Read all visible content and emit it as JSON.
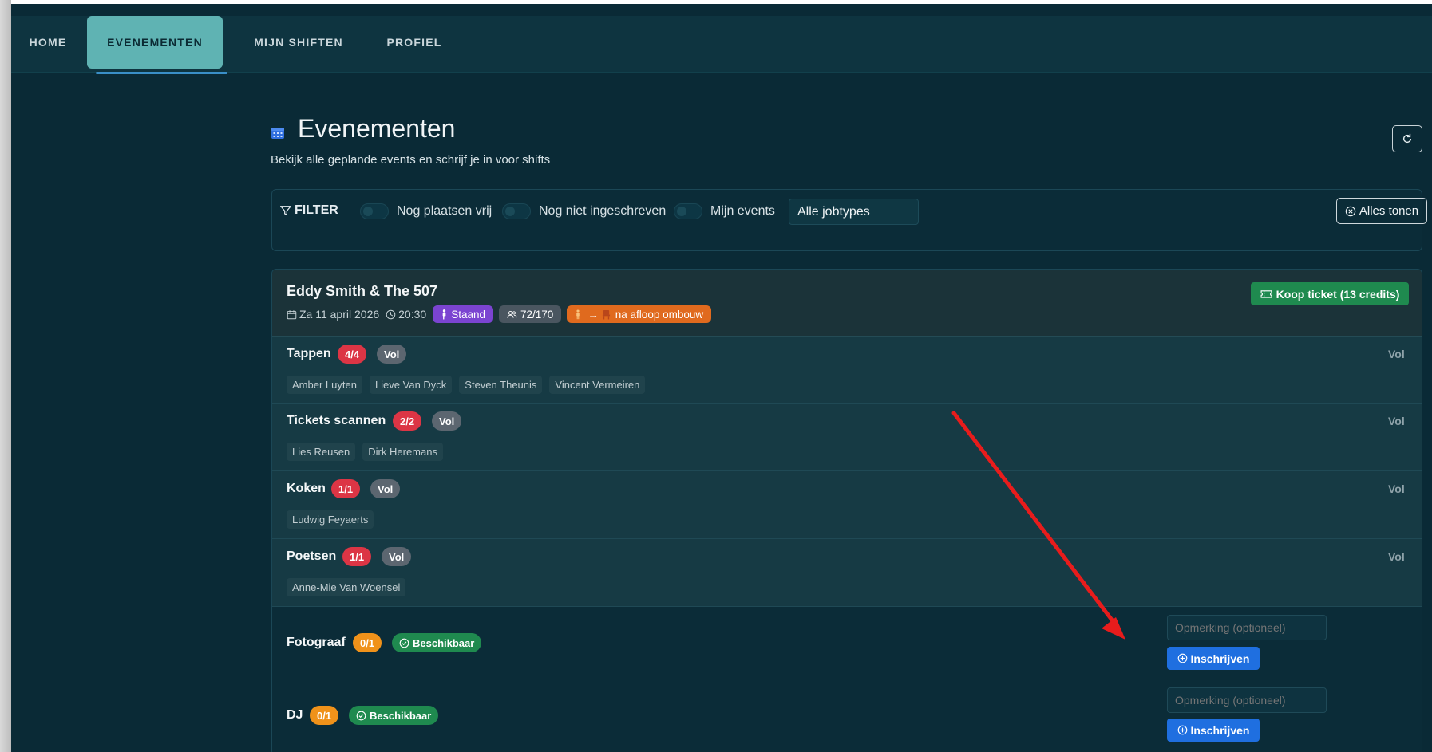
{
  "nav": {
    "items": [
      {
        "label": "HOME"
      },
      {
        "label": "EVENEMENTEN"
      },
      {
        "label": "MIJN SHIFTEN"
      },
      {
        "label": "PROFIEL"
      }
    ]
  },
  "header": {
    "title": "Evenementen",
    "subtitle": "Bekijk alle geplande events en schrijf je in voor shifts"
  },
  "filter": {
    "label": "FILTER",
    "toggles": [
      {
        "label": "Nog plaatsen vrij"
      },
      {
        "label": "Nog niet ingeschreven"
      },
      {
        "label": "Mijn events"
      }
    ],
    "jobtype_select": "Alle jobtypes",
    "reset_label": "Alles tonen"
  },
  "event": {
    "title": "Eddy Smith & The 507",
    "date": "Za 11 april 2026",
    "time": "20:30",
    "type_badge": "Staand",
    "capacity": "72/170",
    "arrow_glyph": "→",
    "note_badge": "na afloop ombouw",
    "ticket_button": "Koop ticket (13 credits)",
    "jobs_full": [
      {
        "name": "Tappen",
        "count": "4/4",
        "status": "Vol",
        "right": "Vol",
        "volunteers": [
          "Amber Luyten",
          "Lieve Van Dyck",
          "Steven Theunis",
          "Vincent Vermeiren"
        ]
      },
      {
        "name": "Tickets scannen",
        "count": "2/2",
        "status": "Vol",
        "right": "Vol",
        "volunteers": [
          "Lies Reusen",
          "Dirk Heremans"
        ]
      },
      {
        "name": "Koken",
        "count": "1/1",
        "status": "Vol",
        "right": "Vol",
        "volunteers": [
          "Ludwig Feyaerts"
        ]
      },
      {
        "name": "Poetsen",
        "count": "1/1",
        "status": "Vol",
        "right": "Vol",
        "volunteers": [
          "Anne-Mie Van Woensel"
        ]
      }
    ],
    "jobs_open": [
      {
        "name": "Fotograaf",
        "count": "0/1",
        "status": "Beschikbaar",
        "remark_placeholder": "Opmerking (optioneel)",
        "signup_label": "Inschrijven"
      },
      {
        "name": "DJ",
        "count": "0/1",
        "status": "Beschikbaar",
        "remark_placeholder": "Opmerking (optioneel)",
        "signup_label": "Inschrijven"
      }
    ]
  },
  "colors": {
    "background": "#0a2a36",
    "nav_active": "#5fb3b3",
    "danger": "#dc3545",
    "success": "#1f8a4f",
    "primary": "#1f6fe0",
    "warning": "#f0921a",
    "annotation_arrow": "#e81c1c"
  }
}
